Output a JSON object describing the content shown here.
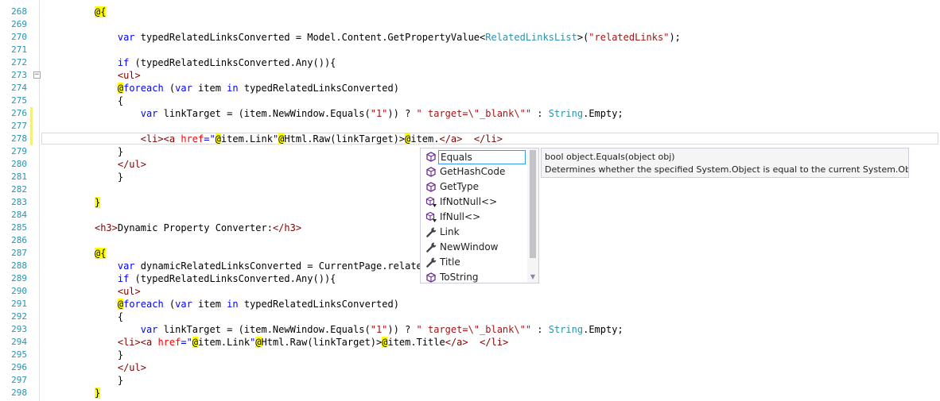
{
  "lines": [
    {
      "num": "268",
      "tokens": [
        {
          "t": "@{",
          "c": "razor"
        }
      ],
      "indent": 9
    },
    {
      "num": "269",
      "tokens": [],
      "indent": 0
    },
    {
      "num": "270",
      "tokens": [
        {
          "t": "var",
          "c": "kw"
        },
        {
          "t": " typedRelatedLinksConverted = Model.Content.GetPropertyValue<",
          "c": ""
        },
        {
          "t": "RelatedLinksList",
          "c": "typ"
        },
        {
          "t": ">(",
          "c": ""
        },
        {
          "t": "\"relatedLinks\"",
          "c": "str"
        },
        {
          "t": ");",
          "c": ""
        }
      ],
      "indent": 13
    },
    {
      "num": "271",
      "tokens": [],
      "indent": 0
    },
    {
      "num": "272",
      "tokens": [
        {
          "t": "if",
          "c": "kw"
        },
        {
          "t": " (typedRelatedLinksConverted.Any()){",
          "c": ""
        }
      ],
      "indent": 13
    },
    {
      "num": "273",
      "tokens": [
        {
          "t": "<ul>",
          "c": "tag"
        }
      ],
      "indent": 13
    },
    {
      "num": "274",
      "tokens": [
        {
          "t": "@",
          "c": "razor"
        },
        {
          "t": "foreach",
          "c": "kw"
        },
        {
          "t": " (",
          "c": ""
        },
        {
          "t": "var",
          "c": "kw"
        },
        {
          "t": " item ",
          "c": ""
        },
        {
          "t": "in",
          "c": "kw"
        },
        {
          "t": " typedRelatedLinksConverted)",
          "c": ""
        }
      ],
      "indent": 13
    },
    {
      "num": "275",
      "tokens": [
        {
          "t": "{",
          "c": ""
        }
      ],
      "indent": 13
    },
    {
      "num": "276",
      "tokens": [
        {
          "t": "var",
          "c": "kw"
        },
        {
          "t": " linkTarget = (item.NewWindow.Equals(",
          "c": ""
        },
        {
          "t": "\"1\"",
          "c": "str"
        },
        {
          "t": ")) ? ",
          "c": ""
        },
        {
          "t": "\" target=\\\"_blank\\\"\"",
          "c": "str"
        },
        {
          "t": " : ",
          "c": ""
        },
        {
          "t": "String",
          "c": "typ"
        },
        {
          "t": ".Empty;",
          "c": ""
        }
      ],
      "indent": 17
    },
    {
      "num": "277",
      "tokens": [],
      "indent": 0
    },
    {
      "num": "278",
      "tokens": [
        {
          "t": "<li><a ",
          "c": "tag"
        },
        {
          "t": "href",
          "c": "attr"
        },
        {
          "t": "=\"",
          "c": "kw"
        },
        {
          "t": "@",
          "c": "razor"
        },
        {
          "t": "item.Link",
          "c": ""
        },
        {
          "t": "\"",
          "c": "kw"
        },
        {
          "t": "@",
          "c": "razor"
        },
        {
          "t": "Html.Raw(linkTarget)>",
          "c": ""
        },
        {
          "t": "@",
          "c": "razor"
        },
        {
          "t": "item.",
          "c": ""
        },
        {
          "t": "</a>",
          "c": "tag"
        },
        {
          "t": "  ",
          "c": ""
        },
        {
          "t": "</li>",
          "c": "tag"
        }
      ],
      "indent": 17
    },
    {
      "num": "279",
      "tokens": [
        {
          "t": "}",
          "c": ""
        }
      ],
      "indent": 13
    },
    {
      "num": "280",
      "tokens": [
        {
          "t": "</ul>",
          "c": "tag"
        }
      ],
      "indent": 13
    },
    {
      "num": "281",
      "tokens": [
        {
          "t": "}",
          "c": ""
        }
      ],
      "indent": 13
    },
    {
      "num": "282",
      "tokens": [],
      "indent": 0
    },
    {
      "num": "283",
      "tokens": [
        {
          "t": "}",
          "c": "razor"
        }
      ],
      "indent": 9
    },
    {
      "num": "284",
      "tokens": [],
      "indent": 0
    },
    {
      "num": "285",
      "tokens": [
        {
          "t": "<h3>",
          "c": "tag"
        },
        {
          "t": "Dynamic Property Converter:",
          "c": ""
        },
        {
          "t": "</h3>",
          "c": "tag"
        }
      ],
      "indent": 9
    },
    {
      "num": "286",
      "tokens": [],
      "indent": 0
    },
    {
      "num": "287",
      "tokens": [
        {
          "t": "@{",
          "c": "razor"
        }
      ],
      "indent": 9
    },
    {
      "num": "288",
      "tokens": [
        {
          "t": "var",
          "c": "kw"
        },
        {
          "t": " dynamicRelatedLinksConverted = CurrentPage.relatedLi",
          "c": ""
        }
      ],
      "indent": 13
    },
    {
      "num": "289",
      "tokens": [
        {
          "t": "if",
          "c": "kw"
        },
        {
          "t": " (typedRelatedLinksConverted.Any()){",
          "c": ""
        }
      ],
      "indent": 13
    },
    {
      "num": "290",
      "tokens": [
        {
          "t": "<ul>",
          "c": "tag"
        }
      ],
      "indent": 13
    },
    {
      "num": "291",
      "tokens": [
        {
          "t": "@",
          "c": "razor"
        },
        {
          "t": "foreach",
          "c": "kw"
        },
        {
          "t": " (",
          "c": ""
        },
        {
          "t": "var",
          "c": "kw"
        },
        {
          "t": " item ",
          "c": ""
        },
        {
          "t": "in",
          "c": "kw"
        },
        {
          "t": " typedRelatedLinksConverted)",
          "c": ""
        }
      ],
      "indent": 13
    },
    {
      "num": "292",
      "tokens": [
        {
          "t": "{",
          "c": ""
        }
      ],
      "indent": 13
    },
    {
      "num": "293",
      "tokens": [
        {
          "t": "var",
          "c": "kw"
        },
        {
          "t": " linkTarget = (item.NewWindow.Equals(",
          "c": ""
        },
        {
          "t": "\"1\"",
          "c": "str"
        },
        {
          "t": ")) ? ",
          "c": ""
        },
        {
          "t": "\" target=\\\"_blank\\\"\"",
          "c": "str"
        },
        {
          "t": " : ",
          "c": ""
        },
        {
          "t": "String",
          "c": "typ"
        },
        {
          "t": ".Empty;",
          "c": ""
        }
      ],
      "indent": 17
    },
    {
      "num": "294",
      "tokens": [
        {
          "t": "<li><a ",
          "c": "tag"
        },
        {
          "t": "href",
          "c": "attr"
        },
        {
          "t": "=\"",
          "c": "kw"
        },
        {
          "t": "@",
          "c": "razor"
        },
        {
          "t": "item.Link",
          "c": ""
        },
        {
          "t": "\"",
          "c": "kw"
        },
        {
          "t": "@",
          "c": "razor"
        },
        {
          "t": "Html.Raw(linkTarget)>",
          "c": ""
        },
        {
          "t": "@",
          "c": "razor"
        },
        {
          "t": "item.Title",
          "c": ""
        },
        {
          "t": "</a>",
          "c": "tag"
        },
        {
          "t": "  ",
          "c": ""
        },
        {
          "t": "</li>",
          "c": "tag"
        }
      ],
      "indent": 13
    },
    {
      "num": "295",
      "tokens": [
        {
          "t": "}",
          "c": ""
        }
      ],
      "indent": 13
    },
    {
      "num": "296",
      "tokens": [
        {
          "t": "</ul>",
          "c": "tag"
        }
      ],
      "indent": 13
    },
    {
      "num": "297",
      "tokens": [
        {
          "t": "}",
          "c": ""
        }
      ],
      "indent": 13
    },
    {
      "num": "298",
      "tokens": [
        {
          "t": "}",
          "c": "razor"
        }
      ],
      "indent": 9
    }
  ],
  "completion": {
    "items": [
      {
        "label": "Equals",
        "icon": "method-icon",
        "selected": true
      },
      {
        "label": "GetHashCode",
        "icon": "method-icon"
      },
      {
        "label": "GetType",
        "icon": "method-icon"
      },
      {
        "label": "IfNotNull<>",
        "icon": "extension-method-icon"
      },
      {
        "label": "IfNull<>",
        "icon": "extension-method-icon"
      },
      {
        "label": "Link",
        "icon": "property-wrench-icon"
      },
      {
        "label": "NewWindow",
        "icon": "property-wrench-icon"
      },
      {
        "label": "Title",
        "icon": "property-wrench-icon"
      },
      {
        "label": "ToString",
        "icon": "method-icon"
      }
    ]
  },
  "tooltip": {
    "signature": "bool object.Equals(object obj)",
    "description": "Determines whether the specified System.Object is equal to the current System.Object."
  },
  "colors": {
    "line_number": "#2b91af",
    "keyword": "#0000ff",
    "string": "#a31515",
    "type": "#2b91af",
    "html_tag": "#800000",
    "html_attr": "#ff0000",
    "razor_highlight": "#ffff00",
    "method_icon": "#6c2d91",
    "change_marker": "#f3ef7b"
  }
}
